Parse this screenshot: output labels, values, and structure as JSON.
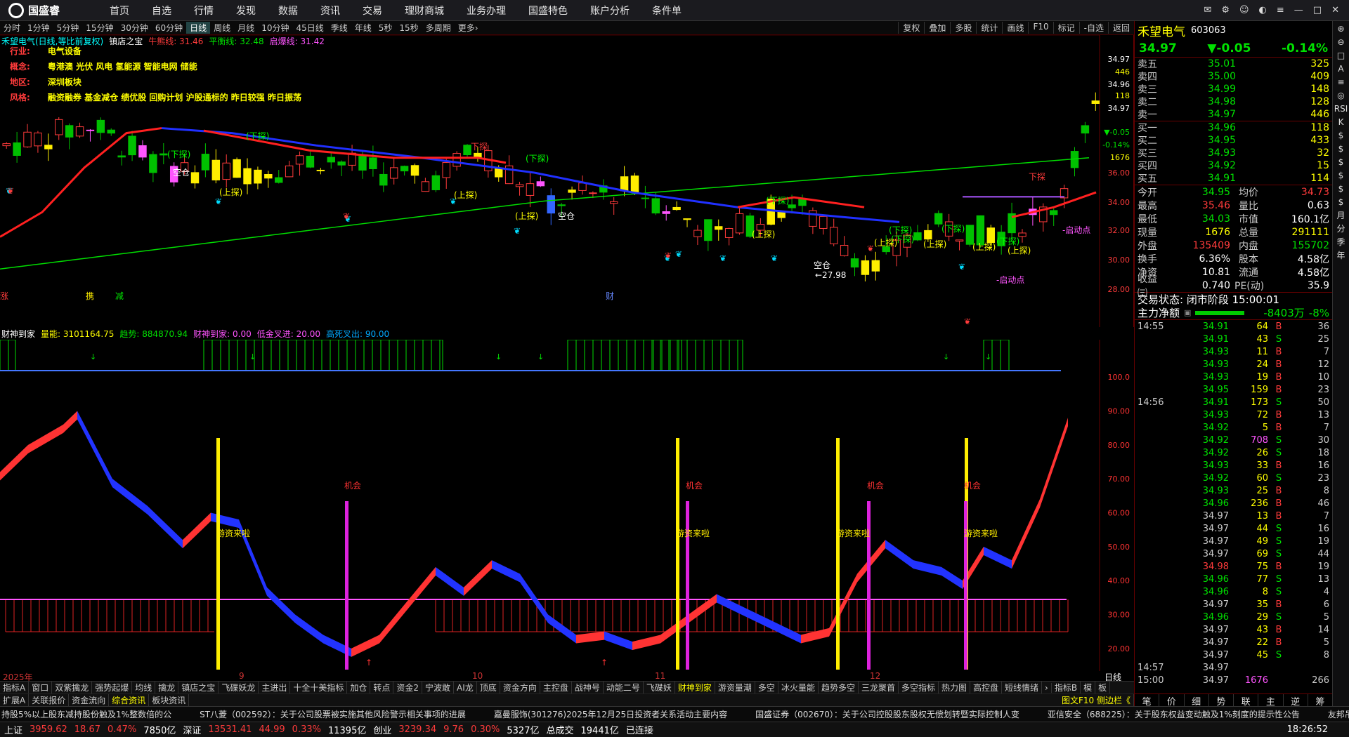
{
  "app": {
    "brand": "国盛睿",
    "menu": [
      "首页",
      "自选",
      "行情",
      "发现",
      "数据",
      "资讯",
      "交易",
      "理财商城",
      "业务办理",
      "国盛特色",
      "账户分析",
      "条件单"
    ]
  },
  "toolbar": {
    "periods": [
      "分时",
      "1分钟",
      "5分钟",
      "15分钟",
      "30分钟",
      "60分钟",
      "日线",
      "周线",
      "月线",
      "10分钟",
      "45日线",
      "季线",
      "年线",
      "5秒",
      "15秒",
      "多周期",
      "更多›"
    ],
    "active": "日线",
    "right": [
      "复权",
      "叠加",
      "多股",
      "统计",
      "画线",
      "F10",
      "标记",
      "-自选",
      "返回"
    ]
  },
  "chart_header": {
    "name": "禾望电气(日线,等比前复权)",
    "indicator": "镇店之宝",
    "lines": [
      {
        "label": "牛熊线: 31.46",
        "color": "#ff3b3b"
      },
      {
        "label": "平衡线: 32.48",
        "color": "#00e000"
      },
      {
        "label": "启爆线: 31.42",
        "color": "#ff55ff"
      }
    ]
  },
  "info_overlay": {
    "industry_label": "行业:",
    "industry": "电气设备",
    "concept_label": "概念:",
    "concepts": "粤港澳 光伏 风电 氢能源 智能电网 储能",
    "region_label": "地区:",
    "region": "深圳板块",
    "style_label": "风格:",
    "styles": "融资融券 基金减仓 绩优股 回购计划 沪股通标的 昨日较强 昨日振荡"
  },
  "price_axis": [
    "34.97",
    "446",
    "34.96",
    "118",
    "34.97",
    "▼-0.05",
    "-0.14%",
    "1676",
    "36.00",
    "34.00",
    "32.00",
    "30.00",
    "28.00"
  ],
  "chart_marks": {
    "down_probe": "(下探)",
    "up_probe": "(上探)",
    "xiatan": "下探",
    "kongcang": "空仓",
    "qidongdian": "-启动点",
    "low_label": "←27.98",
    "cai": "财",
    "zhang": "涨",
    "huo": "携",
    "jian": "减"
  },
  "indicator_header": {
    "name": "财神到家",
    "items": [
      {
        "label": "量能: 3101164.75",
        "color": "#ffff00"
      },
      {
        "label": "趋势: 884870.94",
        "color": "#00e000"
      },
      {
        "label": "财神到家: 0.00",
        "color": "#ff55ff"
      },
      {
        "label": "低金叉进: 20.00",
        "color": "#ff55ff"
      },
      {
        "label": "高死叉出: 90.00",
        "color": "#00aaff"
      }
    ]
  },
  "ind_axis": [
    "100.0",
    "90.00",
    "80.00",
    "70.00",
    "60.00",
    "50.00",
    "40.00",
    "30.00",
    "20.00"
  ],
  "ind_marks": {
    "jihui": "机会",
    "youzi": "游资来啦"
  },
  "date_axis": [
    "2025年",
    "9",
    "10",
    "11",
    "12"
  ],
  "date_axis_right": "日线",
  "tabs_row1": [
    "指标A",
    "窗口",
    "双紫擒龙",
    "强势起爆",
    "均线",
    "擒龙",
    "镇店之宝",
    "飞碟妖龙",
    "主进出",
    "十全十美指标",
    "加仓",
    "转点",
    "资金2",
    "宁波敢",
    "AI龙",
    "顶底",
    "资金方向",
    "主控盘",
    "战神号",
    "动能二号",
    "飞碟妖",
    "财神到家",
    "游资量潮",
    "多空",
    "冰火量能",
    "趋势多空",
    "三龙聚首",
    "多空指标",
    "热力图",
    "高控盘",
    "短线情绪",
    "›",
    "指标B",
    "模",
    "板"
  ],
  "tabs_row1_active": "财神到家",
  "tabs_row2": [
    "扩展A",
    "关联报价",
    "资金流向",
    "综合资讯",
    "板块资讯"
  ],
  "tabs_row2_right": "图文F10 侧边栏《",
  "news": [
    "持股5%以上股东减持股份触及1%整数倍的公",
    "ST八菱（002592）：关于公司股票被实施其他风险警示相关事项的进展",
    "嘉曼服饰(301276)2025年12月25日投资者关系活动主要内容",
    "国盛证券（002670）：关于公司控股股东股权无偿划转暨实际控制人变",
    "亚信安全（688225）：关于股东权益变动触及1%刻度的提示性公告",
    "友邦吊顶（"
  ],
  "status": {
    "items": [
      {
        "k": "上证",
        "v": "3959.62",
        "c": "18.67",
        "p": "0.47%",
        "a": "7850亿"
      },
      {
        "k": "深证",
        "v": "13531.41",
        "c": "44.99",
        "p": "0.33%",
        "a": "11395亿"
      },
      {
        "k": "创业",
        "v": "3239.34",
        "c": "9.76",
        "p": "0.30%",
        "a": "5327亿"
      }
    ],
    "total_label": "总成交",
    "total": "19441亿",
    "conn": "已连接",
    "time": "18:26:52"
  },
  "quote": {
    "name": "禾望电气",
    "code": "603063",
    "price": "34.97",
    "change": "▼-0.05",
    "pct": "-0.14%",
    "asks": [
      [
        "卖五",
        "35.01",
        "325"
      ],
      [
        "卖四",
        "35.00",
        "409"
      ],
      [
        "卖三",
        "34.99",
        "148"
      ],
      [
        "卖二",
        "34.98",
        "128"
      ],
      [
        "卖一",
        "34.97",
        "446"
      ]
    ],
    "bids": [
      [
        "买一",
        "34.96",
        "118"
      ],
      [
        "买二",
        "34.95",
        "433"
      ],
      [
        "买三",
        "34.93",
        "32"
      ],
      [
        "买四",
        "34.92",
        "15"
      ],
      [
        "买五",
        "34.91",
        "114"
      ]
    ],
    "stats": [
      [
        "今开",
        "34.95",
        "均价",
        "34.73"
      ],
      [
        "最高",
        "35.46",
        "量比",
        "0.63"
      ],
      [
        "最低",
        "34.03",
        "市值",
        "160.1亿"
      ],
      [
        "现量",
        "1676",
        "总量",
        "291111"
      ],
      [
        "外盘",
        "135409",
        "内盘",
        "155702"
      ],
      [
        "换手",
        "6.36%",
        "股本",
        "4.58亿"
      ],
      [
        "净资",
        "10.81",
        "流通",
        "4.58亿"
      ],
      [
        "收益㈢",
        "0.740",
        "PE(动)",
        "35.9"
      ]
    ],
    "trade_status": "交易状态: 闭市阶段 15:00:01",
    "netflow_label": "主力净额",
    "netflow": "-8403万",
    "netflow_pct": "-8%",
    "ticks": [
      [
        "14:55",
        "34.91",
        "64",
        "B",
        "36"
      ],
      [
        "",
        "34.91",
        "43",
        "S",
        "25"
      ],
      [
        "",
        "34.93",
        "11",
        "B",
        "7"
      ],
      [
        "",
        "34.93",
        "24",
        "B",
        "12"
      ],
      [
        "",
        "34.93",
        "19",
        "B",
        "10"
      ],
      [
        "",
        "34.95",
        "159",
        "B",
        "23"
      ],
      [
        "14:56",
        "34.91",
        "173",
        "S",
        "50"
      ],
      [
        "",
        "34.93",
        "72",
        "B",
        "13"
      ],
      [
        "",
        "34.92",
        "5",
        "B",
        "7"
      ],
      [
        "",
        "34.92",
        "708",
        "S",
        "30"
      ],
      [
        "",
        "34.92",
        "26",
        "S",
        "18"
      ],
      [
        "",
        "34.93",
        "33",
        "B",
        "16"
      ],
      [
        "",
        "34.92",
        "60",
        "S",
        "23"
      ],
      [
        "",
        "34.93",
        "25",
        "B",
        "8"
      ],
      [
        "",
        "34.96",
        "236",
        "B",
        "46"
      ],
      [
        "",
        "34.97",
        "13",
        "B",
        "7"
      ],
      [
        "",
        "34.97",
        "44",
        "S",
        "16"
      ],
      [
        "",
        "34.97",
        "49",
        "S",
        "19"
      ],
      [
        "",
        "34.97",
        "69",
        "S",
        "44"
      ],
      [
        "",
        "34.98",
        "75",
        "B",
        "19"
      ],
      [
        "",
        "34.96",
        "77",
        "S",
        "13"
      ],
      [
        "",
        "34.96",
        "8",
        "S",
        "4"
      ],
      [
        "",
        "34.97",
        "35",
        "B",
        "6"
      ],
      [
        "",
        "34.96",
        "29",
        "S",
        "5"
      ],
      [
        "",
        "34.97",
        "43",
        "B",
        "14"
      ],
      [
        "",
        "34.97",
        "22",
        "B",
        "5"
      ],
      [
        "",
        "34.97",
        "45",
        "S",
        "8"
      ],
      [
        "14:57",
        "34.97",
        "",
        "",
        ""
      ],
      [
        "15:00",
        "34.97",
        "1676",
        "",
        "266"
      ]
    ],
    "bottom_tabs": [
      "笔",
      "价",
      "细",
      "势",
      "联",
      "主",
      "逆",
      "筹"
    ]
  },
  "sidebar": [
    "⊕",
    "⊖",
    "□",
    "A",
    "≡",
    "◎",
    "RSI",
    "K",
    "$",
    "$",
    "$",
    "$",
    "$",
    "$",
    "月",
    "分",
    "季",
    "年"
  ],
  "chart_data": {
    "type": "candlestick",
    "symbol": "禾望电气",
    "ylim": [
      27,
      37
    ]
  }
}
